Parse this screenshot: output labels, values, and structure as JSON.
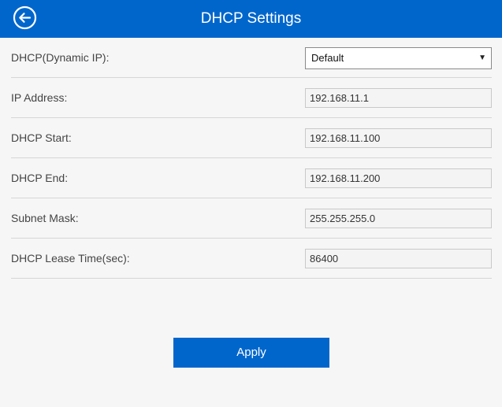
{
  "header": {
    "title": "DHCP Settings",
    "back_icon": "back-arrow-circle-icon"
  },
  "form": {
    "dhcp_mode": {
      "label": "DHCP(Dynamic IP):",
      "value": "Default",
      "caret": "▼"
    },
    "ip_address": {
      "label": "IP Address:",
      "value": "192.168.11.1"
    },
    "dhcp_start": {
      "label": "DHCP Start:",
      "value": "192.168.11.100"
    },
    "dhcp_end": {
      "label": "DHCP End:",
      "value": "192.168.11.200"
    },
    "subnet_mask": {
      "label": "Subnet Mask:",
      "value": "255.255.255.0"
    },
    "lease_time": {
      "label": "DHCP Lease Time(sec):",
      "value": "86400"
    }
  },
  "apply_label": "Apply",
  "colors": {
    "accent": "#0066cc",
    "background": "#f6f6f6"
  }
}
